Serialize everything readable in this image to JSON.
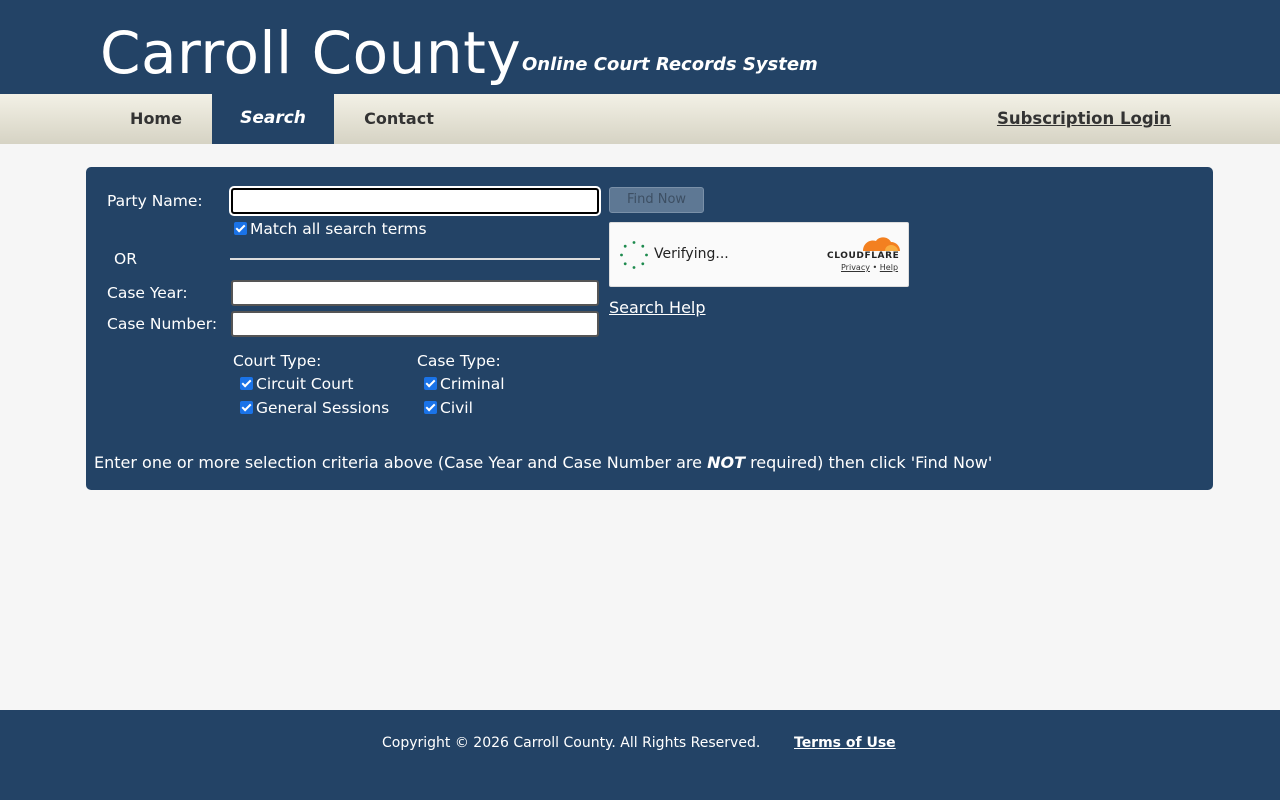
{
  "header": {
    "title": "Carroll County",
    "subtitle": "Online Court Records System"
  },
  "nav": {
    "home": "Home",
    "search": "Search",
    "contact": "Contact",
    "login": "Subscription Login",
    "active": "Search"
  },
  "form": {
    "party_name_label": "Party Name:",
    "party_name_value": "",
    "match_all_label": "Match all search terms",
    "match_all_checked": true,
    "or_label": "OR",
    "case_year_label": "Case Year:",
    "case_year_value": "",
    "case_number_label": "Case Number:",
    "case_number_value": "",
    "court_type_label": "Court Type:",
    "court_types": [
      {
        "label": "Circuit Court",
        "checked": true
      },
      {
        "label": "General Sessions",
        "checked": true
      }
    ],
    "case_type_label": "Case Type:",
    "case_types": [
      {
        "label": "Criminal",
        "checked": true
      },
      {
        "label": "Civil",
        "checked": true
      }
    ],
    "find_button": "Find Now",
    "find_button_disabled": true,
    "search_help": "Search Help",
    "instructions_before": "Enter one or more selection criteria above (Case Year and Case Number are ",
    "instructions_emphasis": "NOT",
    "instructions_after": " required) then click 'Find Now'"
  },
  "captcha": {
    "status": "Verifying...",
    "brand": "CLOUDFLARE",
    "privacy": "Privacy",
    "separator": "•",
    "help": "Help"
  },
  "footer": {
    "copyright": "Copyright © 2026 Carroll County. All Rights Reserved.",
    "terms": "Terms of Use"
  },
  "colors": {
    "primary": "#234366",
    "background": "#f6f6f6",
    "nav_gradient_top": "#f3f1e6",
    "nav_gradient_bottom": "#d6d3c4",
    "checkbox": "#1a73e8",
    "cloudflare_orange": "#f38020"
  }
}
